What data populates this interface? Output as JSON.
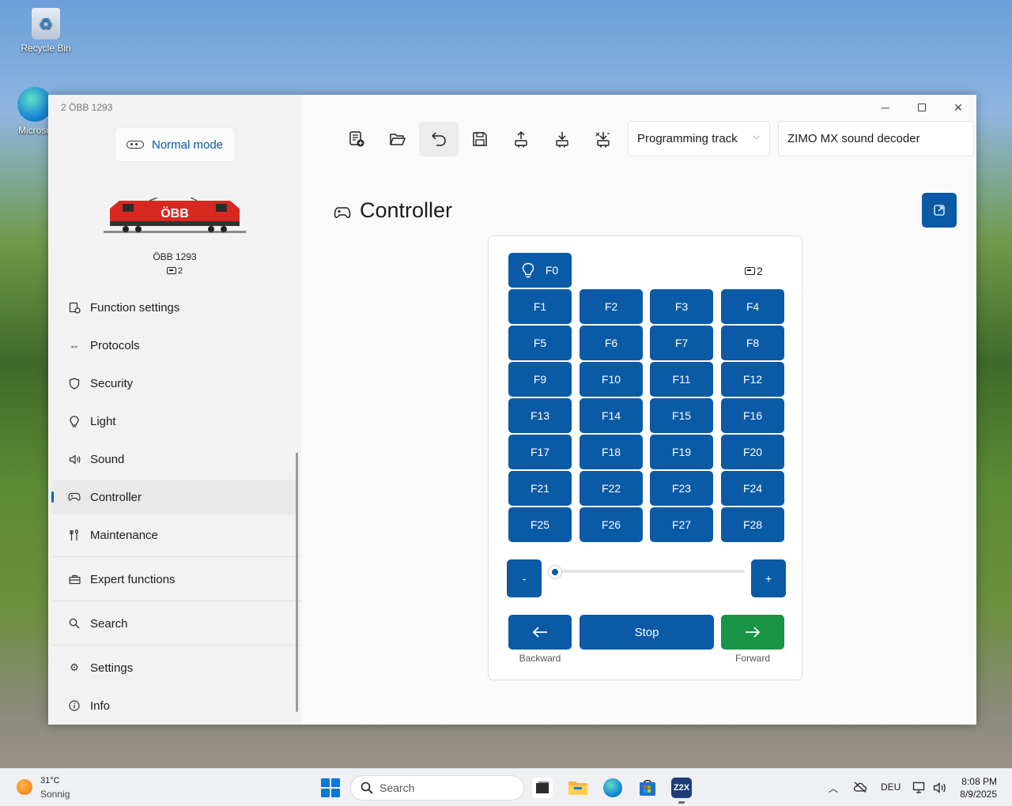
{
  "desktop": {
    "recycle_bin": "Recycle Bin",
    "edge_shortcut": "Microso"
  },
  "window": {
    "title": "2 ÖBB 1293",
    "mode_label": "Normal mode",
    "loco_name": "ÖBB 1293",
    "loco_address": "2",
    "loco_brand": "ÖBB"
  },
  "sidebar": {
    "items": [
      {
        "label": "Function settings",
        "icon": "function-settings-icon"
      },
      {
        "label": "Protocols",
        "icon": "protocols-icon"
      },
      {
        "label": "Security",
        "icon": "shield-icon"
      },
      {
        "label": "Light",
        "icon": "bulb-icon"
      },
      {
        "label": "Sound",
        "icon": "speaker-icon"
      },
      {
        "label": "Controller",
        "icon": "gamepad-icon",
        "active": true
      },
      {
        "label": "Maintenance",
        "icon": "maintenance-icon"
      },
      {
        "label": "Expert functions",
        "icon": "toolbox-icon"
      },
      {
        "label": "Search",
        "icon": "search-icon"
      },
      {
        "label": "Settings",
        "icon": "gear-icon"
      },
      {
        "label": "Info",
        "icon": "info-icon"
      }
    ]
  },
  "toolbar": {
    "track_select": "Programming track",
    "decoder_field": "ZIMO MX sound decoder"
  },
  "page": {
    "title": "Controller"
  },
  "controller": {
    "f0": "F0",
    "address": "2",
    "functions": [
      "F1",
      "F2",
      "F3",
      "F4",
      "F5",
      "F6",
      "F7",
      "F8",
      "F9",
      "F10",
      "F11",
      "F12",
      "F13",
      "F14",
      "F15",
      "F16",
      "F17",
      "F18",
      "F19",
      "F20",
      "F21",
      "F22",
      "F23",
      "F24",
      "F25",
      "F26",
      "F27",
      "F28"
    ],
    "minus": "-",
    "plus": "+",
    "speed": 0,
    "stop": "Stop",
    "backward": "Backward",
    "forward": "Forward",
    "forward_color": "#1a9446",
    "accent": "#0b5aa6"
  },
  "taskbar": {
    "temp": "31°C",
    "weather": "Sonnig",
    "search_placeholder": "Search",
    "language": "DEU",
    "time": "8:08 PM",
    "date": "8/9/2025"
  }
}
